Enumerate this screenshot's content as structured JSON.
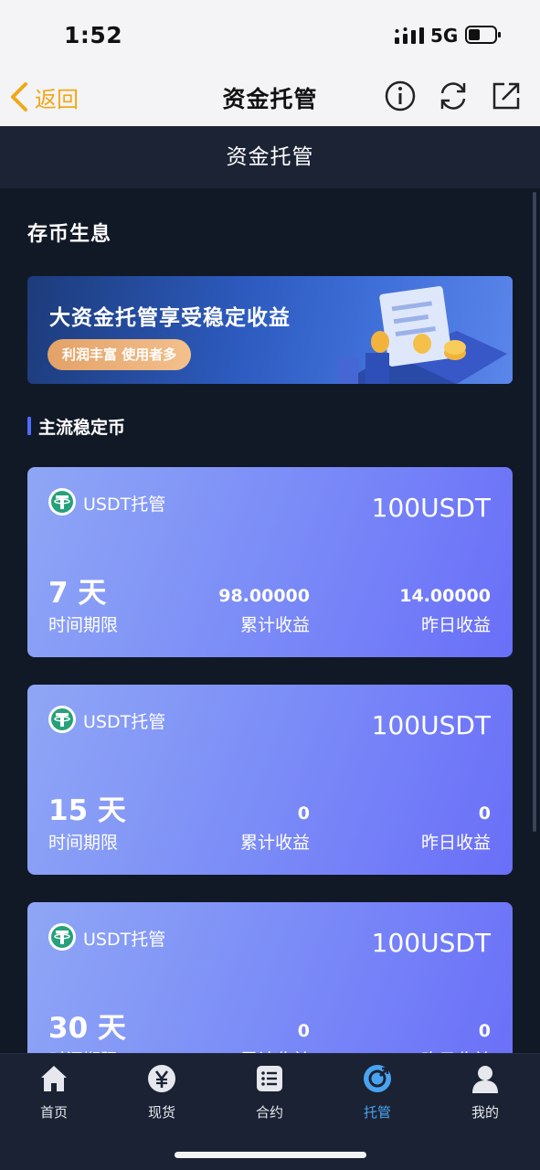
{
  "status_bar": {
    "time": "1:52",
    "network": "5G"
  },
  "nav": {
    "back_label": "返回",
    "title": "资金托管"
  },
  "header": {
    "title": "资金托管"
  },
  "section": {
    "title": "存币生息"
  },
  "banner": {
    "title": "大资金托管享受稳定收益",
    "tag": "利润丰富 使用者多"
  },
  "subsection": {
    "title": "主流稳定币"
  },
  "cards": [
    {
      "name": "USDT托管",
      "amount": "100USDT",
      "days": "7 天",
      "days_label": "时间期限",
      "total_value": "98.00000",
      "total_label": "累计收益",
      "yesterday_value": "14.00000",
      "yesterday_label": "昨日收益"
    },
    {
      "name": "USDT托管",
      "amount": "100USDT",
      "days": "15 天",
      "days_label": "时间期限",
      "total_value": "0",
      "total_label": "累计收益",
      "yesterday_value": "0",
      "yesterday_label": "昨日收益"
    },
    {
      "name": "USDT托管",
      "amount": "100USDT",
      "days": "30 天",
      "days_label": "时间期限",
      "total_value": "0",
      "total_label": "累计收益",
      "yesterday_value": "0",
      "yesterday_label": "昨日收益"
    }
  ],
  "tabs": [
    {
      "label": "首页",
      "icon": "home-icon"
    },
    {
      "label": "现货",
      "icon": "yen-coin-icon"
    },
    {
      "label": "合约",
      "icon": "list-icon"
    },
    {
      "label": "托管",
      "icon": "custody-icon",
      "active": true
    },
    {
      "label": "我的",
      "icon": "user-icon"
    }
  ],
  "colors": {
    "accent": "#4aa3f0",
    "back": "#f0a818",
    "card_start": "#8fa6f5",
    "card_end": "#6a6ff8",
    "background": "#111826"
  }
}
